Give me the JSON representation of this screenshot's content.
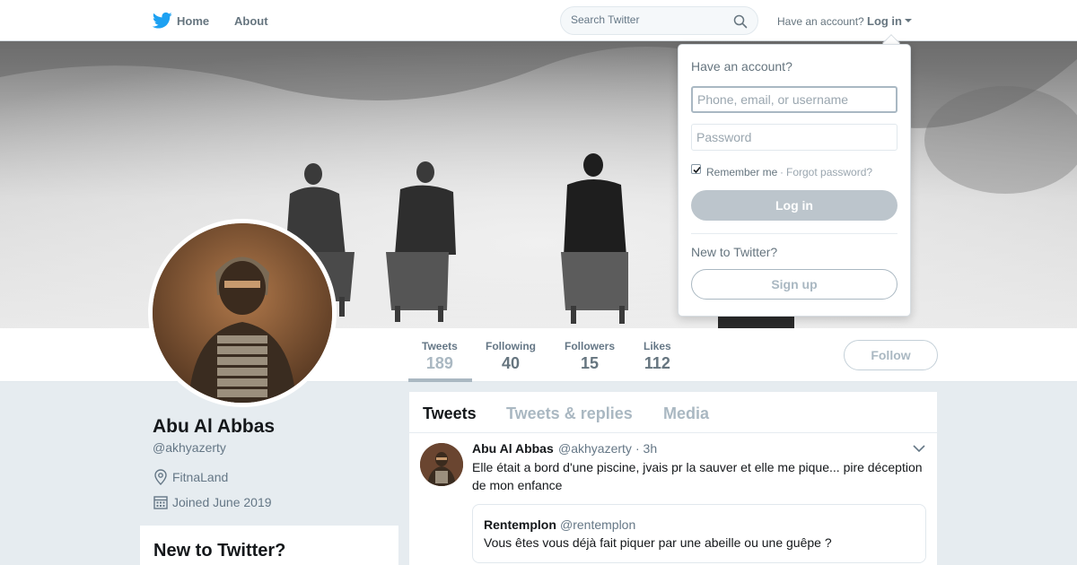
{
  "nav": {
    "logo_icon": "twitter-bird-icon",
    "home_label": "Home",
    "about_label": "About",
    "search_placeholder": "Search Twitter",
    "have_account": "Have an account?",
    "login_label": "Log in"
  },
  "banner": {
    "description_icon": "banner-image"
  },
  "profile": {
    "name": "Abu Al Abbas",
    "handle": "@akhyazerty",
    "location": "FitnaLand",
    "joined": "Joined June 2019"
  },
  "stats": [
    {
      "label": "Tweets",
      "value": "189"
    },
    {
      "label": "Following",
      "value": "40"
    },
    {
      "label": "Followers",
      "value": "15"
    },
    {
      "label": "Likes",
      "value": "112"
    }
  ],
  "follow_label": "Follow",
  "sidebar": {
    "new_to_twitter": "New to Twitter?"
  },
  "timeline": {
    "tabs": [
      "Tweets",
      "Tweets & replies",
      "Media"
    ],
    "tweet": {
      "name": "Abu Al Abbas",
      "handle": "@akhyazerty",
      "time": "· 3h",
      "text": "Elle était a bord d'une piscine, jvais pr la sauver et elle me pique... pire déception de mon enfance",
      "quote": {
        "name": "Rentemplon",
        "handle": "@rentemplon",
        "text": "Vous êtes vous déjà fait piquer par une abeille ou une guêpe ?"
      }
    }
  },
  "login_dropdown": {
    "title": "Have an account?",
    "username_placeholder": "Phone, email, or username",
    "password_placeholder": "Password",
    "remember_label": "Remember me",
    "remember_checked": true,
    "separator": "·",
    "forgot_label": "Forgot password?",
    "login_button": "Log in",
    "new_label": "New to Twitter?",
    "signup_button": "Sign up"
  },
  "colors": {
    "brand": "#1da1f2",
    "text_secondary": "#657786",
    "muted": "#aab8c2"
  }
}
